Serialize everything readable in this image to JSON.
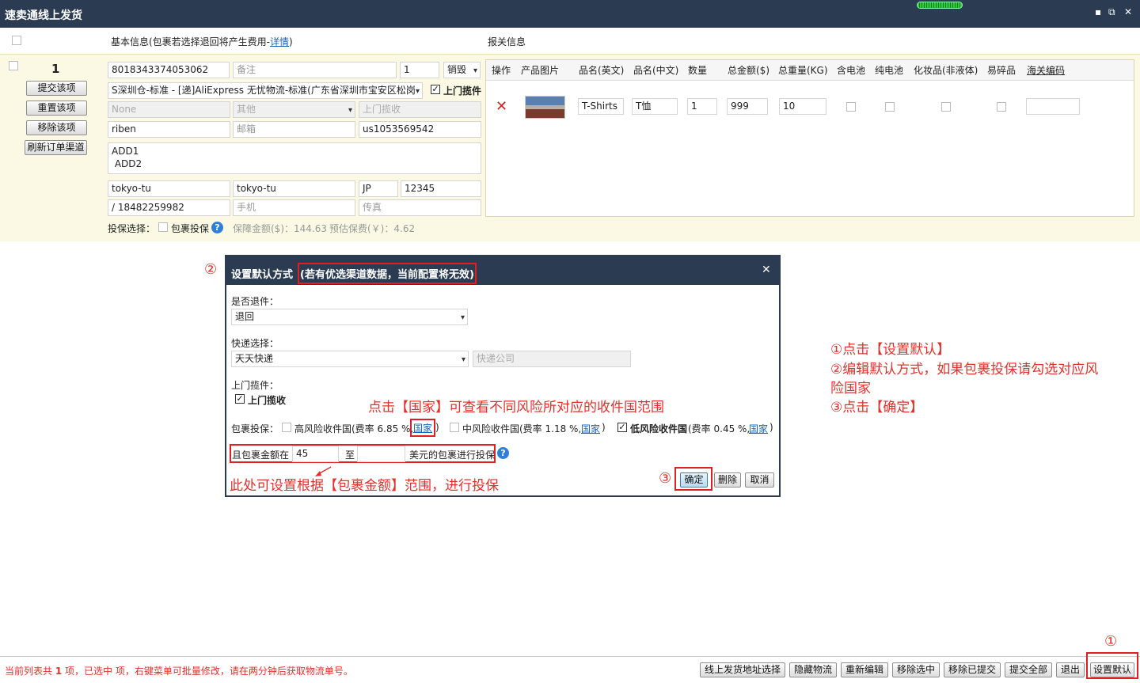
{
  "window": {
    "title": "速卖通线上发货",
    "min": "▪",
    "restore": "⧉",
    "close": "✕"
  },
  "header": {
    "basic_info": "基本信息(包裹若选择退回将产生费用-",
    "detail_link": "详情",
    "basic_info_close": ")",
    "customs_info": "报关信息"
  },
  "order": {
    "index": "1",
    "buttons": {
      "submit": "提交该项",
      "reset": "重置该项",
      "remove": "移除该项",
      "refresh": "刷新订单渠道"
    },
    "tracking_no": "8018343374053062",
    "remark_ph": "备注",
    "qty": "1",
    "sale_type": "销毁",
    "channel": "S深圳仓-标准 - [递]AliExpress 无忧物流-标准(广东省深圳市宝安区松岗",
    "pickup_label": "上门揽件",
    "none_val": "None",
    "other_ph": "其他",
    "pickup_ph": "上门揽收",
    "name": "riben",
    "email_ph": "邮箱",
    "user_id": "us1053569542",
    "address": "ADD1\n ADD2",
    "city": "tokyo-tu",
    "state": "tokyo-tu",
    "country": "JP",
    "zip": "12345",
    "phone": " / 18482259982",
    "mobile_ph": "手机",
    "fax_ph": "传真",
    "insurance_label": "投保选择：",
    "insurance_check": "包裹投保",
    "insured_amount": "保障金额($)：144.63",
    "estimated_fee": "预估保费(￥)：4.62"
  },
  "customs": {
    "headers": [
      "操作",
      "产品图片",
      "品名(英文)",
      "品名(中文)",
      "数量",
      "总金额($)",
      "总重量(KG)",
      "含电池",
      "纯电池",
      "化妆品(非液体)",
      "易碎品",
      "海关编码"
    ],
    "row": {
      "delete_icon": "✕",
      "name_en": "T-Shirts",
      "name_cn": "T恤",
      "qty": "1",
      "amount": "999",
      "weight": "10"
    }
  },
  "dialog": {
    "title": "设置默认方式",
    "title_warning": "(若有优选渠道数据，当前配置将无效)",
    "close": "✕",
    "return_label": "是否退件：",
    "return_value": "退回",
    "express_label": "快递选择：",
    "express_value": "天天快递",
    "express_company_ph": "快递公司",
    "pickup_label": "上门揽件：",
    "pickup_check": "上门揽收",
    "insure_label": "包裹投保：",
    "high_risk": "高风险收件国(费率 6.85 %,",
    "mid_risk": "中风险收件国(费率 1.18 %,",
    "low_risk_bold": "低风险收件国",
    "low_risk": "(费率 0.45 %,",
    "country_link": "国家",
    "paren_close": ")",
    "amount_prefix": "且包裹金额在",
    "amount_from": "45",
    "amount_to_label": "至",
    "amount_to": "",
    "amount_suffix": "美元的包裹进行投保",
    "ok": "确定",
    "delete": "删除",
    "cancel": "取消"
  },
  "annotations": {
    "num1": "①",
    "num2": "②",
    "num3": "③",
    "country_tip": "点击【国家】可查看不同风险所对应的收件国范围",
    "amount_tip": "此处可设置根据【包裹金额】范围，进行投保",
    "steps": [
      "①点击【设置默认】",
      "②编辑默认方式，如果包裹投保请勾选对应风",
      "险国家",
      "③点击【确定】"
    ]
  },
  "footer": {
    "status_pre": "当前列表共",
    "status_count": "1",
    "status_post": "项，已选中  项，右键菜单可批量修改，请在两分钟后获取物流单号。",
    "buttons": [
      "线上发货地址选择",
      "隐藏物流",
      "重新编辑",
      "移除选中",
      "移除已提交",
      "提交全部",
      "退出",
      "设置默认"
    ]
  },
  "colors": {
    "titlebar": "#2b3b52",
    "order_bg": "#fbf9e4",
    "annotation": "#e4302a",
    "link": "#1565c0"
  }
}
